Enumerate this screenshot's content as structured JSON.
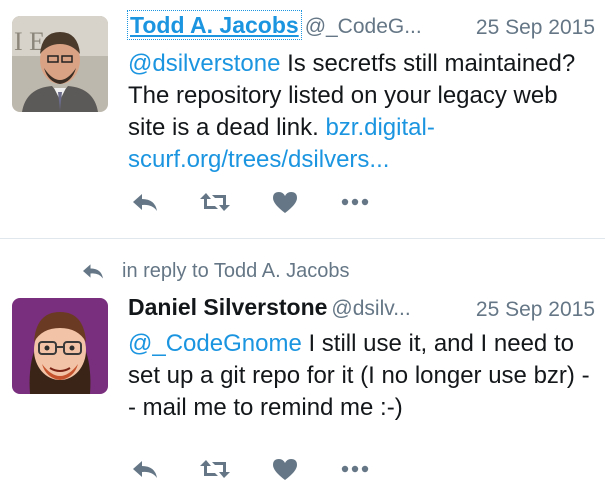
{
  "tweets": [
    {
      "author_name": "Todd A. Jacobs",
      "author_handle": "@_CodeG...",
      "date": "25 Sep 2015",
      "text_mention": "@dsilverstone",
      "text_body": " Is secretfs still maintained? The repository listed on your legacy web site is a dead link. ",
      "text_link": "bzr.digital-scurf.org/trees/dsilvers..."
    },
    {
      "in_reply_to": "in reply to Todd A. Jacobs",
      "author_name": "Daniel Silverstone",
      "author_handle": "@dsilv...",
      "date": "25 Sep 2015",
      "text_mention": "@_CodeGnome",
      "text_body": " I still use it, and I need to set up a git repo for it (I no longer use bzr) -- mail me to remind me :-)"
    }
  ],
  "icons": {
    "reply": "reply-icon",
    "retweet": "retweet-icon",
    "like": "heart-icon",
    "more": "more-icon"
  },
  "colors": {
    "link": "#1b95e0",
    "muted": "#657786",
    "icon": "#657786",
    "divider": "#e1e8ed"
  }
}
